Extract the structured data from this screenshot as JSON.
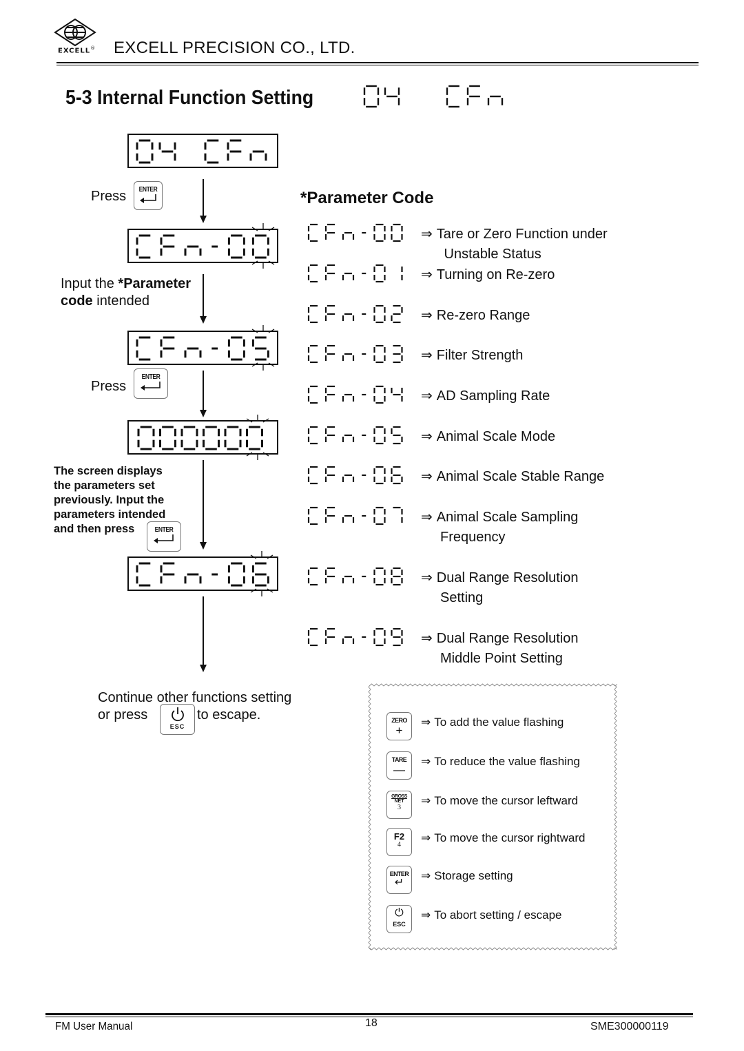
{
  "header": {
    "logo_text": "EXCELL",
    "logo_mark": "®",
    "company": "EXCELL PRECISION CO., LTD."
  },
  "section": {
    "title": "5-3 Internal Function Setting",
    "display_code": "04  CFn"
  },
  "flow": {
    "display_1": "04 CFn",
    "press_label_1": "Press",
    "enter_key_label": "ENTER",
    "display_2": "CFn-00",
    "input_label_normal_1": "Input the ",
    "input_label_bold_1": "*Parameter",
    "input_label_bold_2": "code",
    "input_label_normal_2": " intended",
    "display_3": "CFn-05",
    "press_label_2": "Press",
    "display_4": "000000",
    "screen_note_lines": [
      "The screen displays",
      "the parameters set",
      "previously. Input the",
      "parameters intended",
      "and then press"
    ],
    "display_5": "CFn-06",
    "continue_line_1": "Continue other functions setting",
    "continue_line_2a": "or press",
    "continue_line_2b": "to escape.",
    "esc_key_label": "ESC"
  },
  "parameter_code": {
    "title": "*Parameter Code",
    "arrow": "⇒",
    "items": [
      {
        "code": "CFn-00",
        "lines": [
          "Tare or Zero Function under",
          " Unstable Status"
        ]
      },
      {
        "code": "CFn-01",
        "lines": [
          "Turning on Re-zero"
        ]
      },
      {
        "code": "CFn-02",
        "lines": [
          "Re-zero Range"
        ]
      },
      {
        "code": "CFn-03",
        "lines": [
          "Filter Strength"
        ]
      },
      {
        "code": "CFn-04",
        "lines": [
          "AD Sampling Rate"
        ]
      },
      {
        "code": "CFn-05",
        "lines": [
          "Animal Scale Mode"
        ]
      },
      {
        "code": "CFn-06",
        "lines": [
          "Animal Scale Stable Range"
        ]
      },
      {
        "code": "CFn-07",
        "lines": [
          "Animal Scale Sampling",
          "Frequency"
        ]
      },
      {
        "code": "CFn-08",
        "lines": [
          "Dual Range Resolution",
          "Setting"
        ]
      },
      {
        "code": "CFn-09",
        "lines": [
          "Dual Range Resolution",
          "Middle Point Setting"
        ]
      }
    ]
  },
  "key_legend": {
    "arrow": "⇒",
    "items": [
      {
        "key": "zero-plus",
        "top": "ZERO",
        "bottom": "+",
        "desc": "To add the value flashing"
      },
      {
        "key": "tare-minus",
        "top": "TARE",
        "bottom": "—",
        "desc": "To reduce the value flashing"
      },
      {
        "key": "gross-net-3",
        "top": "GROSS",
        "mid": "NET",
        "bottom": "3",
        "desc": "To move the cursor leftward"
      },
      {
        "key": "f2-4",
        "top": "F2",
        "bottom": "4",
        "desc": "To move the cursor rightward"
      },
      {
        "key": "enter",
        "top": "ENTER",
        "bottom": "↵",
        "desc": "Storage setting"
      },
      {
        "key": "esc",
        "top": "⏻",
        "bottom": "ESC",
        "desc": "To abort setting / escape"
      }
    ]
  },
  "footer": {
    "left": "FM User Manual",
    "page": "18",
    "right": "SME300000119"
  }
}
